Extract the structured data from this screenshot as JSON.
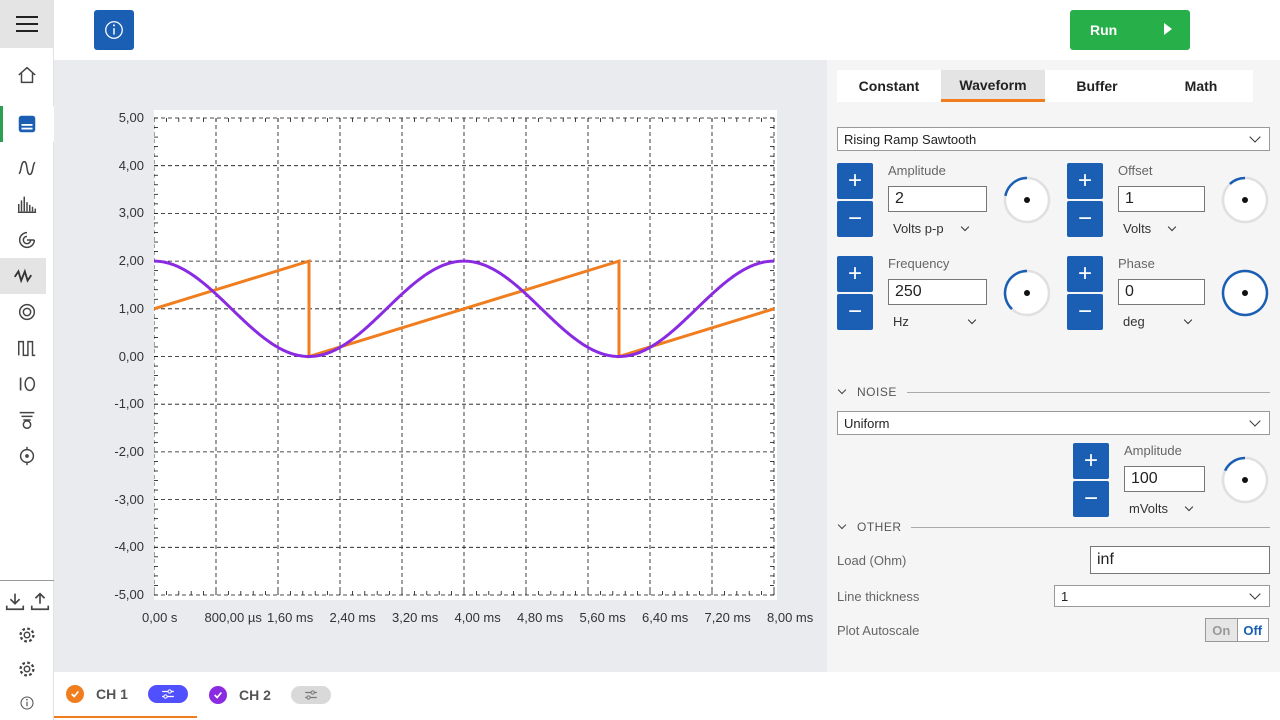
{
  "toolbar": {
    "run_label": "Run"
  },
  "plot": {
    "y_ticks": [
      "5,00",
      "4,00",
      "3,00",
      "2,00",
      "1,00",
      "0,00",
      "-1,00",
      "-2,00",
      "-3,00",
      "-4,00",
      "-5,00"
    ],
    "x_ticks": [
      "0,00 s",
      "800,00 µs",
      "1,60 ms",
      "2,40 ms",
      "3,20 ms",
      "4,00 ms",
      "4,80 ms",
      "5,60 ms",
      "6,40 ms",
      "7,20 ms",
      "8,00 ms"
    ]
  },
  "chart_data": {
    "type": "line",
    "xlim": [
      0,
      8.0
    ],
    "ylim": [
      -5,
      5
    ],
    "x_unit": "ms",
    "grid": true,
    "series": [
      {
        "waveform": "rising-ramp-sawtooth",
        "color": "#f07d1e",
        "period_ms": 4.0,
        "min": 0,
        "max": 2,
        "first_drop_ms": 2.0,
        "start_value": 1.0
      },
      {
        "waveform": "sine",
        "color": "#8a2be2",
        "period_ms": 4.0,
        "min": 0,
        "max": 2,
        "peak_at_ms": 0.0
      }
    ]
  },
  "panel": {
    "tabs": [
      "Constant",
      "Waveform",
      "Buffer",
      "Math"
    ],
    "active_tab": "Waveform",
    "waveform_type": "Rising Ramp Sawtooth",
    "amplitude": {
      "label": "Amplitude",
      "value": "2",
      "unit": "Volts p-p",
      "knob_fraction": 0.22
    },
    "offset": {
      "label": "Offset",
      "value": "1",
      "unit": "Volts",
      "knob_fraction": 0.12
    },
    "frequency": {
      "label": "Frequency",
      "value": "250",
      "unit": "Hz",
      "knob_fraction": 0.38
    },
    "phase": {
      "label": "Phase",
      "value": "0",
      "unit": "deg",
      "knob_fraction": 1.0
    },
    "noise_header": "NOISE",
    "noise_type": "Uniform",
    "noise_amplitude": {
      "label": "Amplitude",
      "value": "100",
      "unit": "mVolts",
      "knob_fraction": 0.18
    },
    "other_header": "OTHER",
    "load_label": "Load (Ohm)",
    "load_value": "inf",
    "line_thickness_label": "Line thickness",
    "line_thickness_value": "1",
    "plot_autoscale_label": "Plot Autoscale",
    "toggle_on": "On",
    "toggle_off": "Off"
  },
  "channels": [
    {
      "label": "CH 1",
      "color": "#f07d1e",
      "settings_color": "#5050ff"
    },
    {
      "label": "CH 2",
      "color": "#8a2be2",
      "settings_color": "#d9d9d9"
    }
  ],
  "colors": {
    "accent_blue": "#1a5fb4",
    "run_green": "#27b04a",
    "tab_orange": "#f07d1e"
  }
}
